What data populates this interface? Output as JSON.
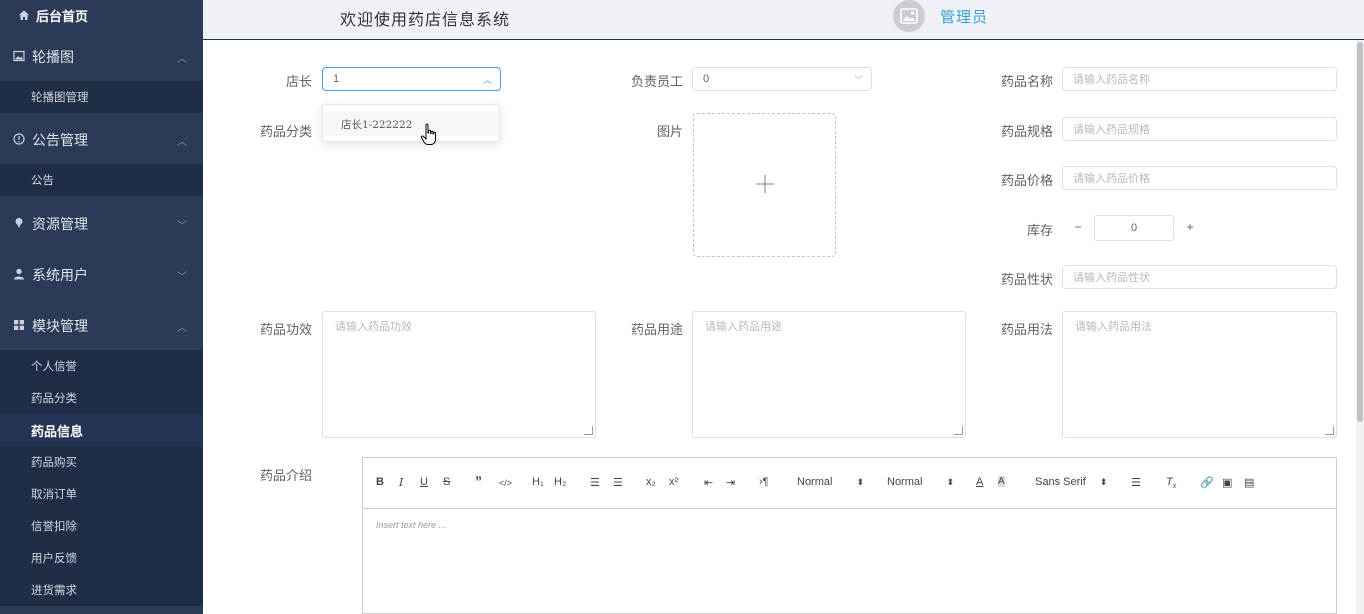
{
  "header": {
    "welcome": "欢迎使用药店信息系统",
    "user": "管理员"
  },
  "sidebar": {
    "home": "后台首页",
    "menus": [
      {
        "label": "轮播图",
        "icon": "image-icon",
        "expanded": true,
        "subs": [
          "轮播图管理"
        ]
      },
      {
        "label": "公告管理",
        "icon": "info-icon",
        "expanded": true,
        "subs": [
          "公告"
        ]
      },
      {
        "label": "资源管理",
        "icon": "pin-icon",
        "expanded": false,
        "subs": []
      },
      {
        "label": "系统用户",
        "icon": "user-icon",
        "expanded": false,
        "subs": []
      },
      {
        "label": "模块管理",
        "icon": "grid-icon",
        "expanded": true,
        "subs": [
          "个人信誉",
          "药品分类",
          "药品信息",
          "药品购买",
          "取消订单",
          "信誉扣除",
          "用户反馈",
          "进货需求"
        ],
        "active": "药品信息"
      }
    ]
  },
  "form": {
    "manager_label": "店长",
    "manager_value": "1",
    "staff_label": "负责员工",
    "staff_value": "0",
    "drug_name_label": "药品名称",
    "drug_name_placeholder": "请输入药品名称",
    "category_label": "药品分类",
    "image_label": "图片",
    "spec_label": "药品规格",
    "spec_placeholder": "请输入药品规格",
    "price_label": "药品价格",
    "price_placeholder": "请输入药品价格",
    "stock_label": "库存",
    "stock_value": "0",
    "property_label": "药品性状",
    "property_placeholder": "请输入药品性状",
    "effect_label": "药品功效",
    "effect_placeholder": "请输入药品功效",
    "usage_label": "药品用途",
    "usage_placeholder": "请输入药品用途",
    "method_label": "药品用法",
    "method_placeholder": "请输入药品用法",
    "intro_label": "药品介绍",
    "dropdown_option": "店长1-222222"
  },
  "editor": {
    "header_select": "Normal",
    "size_select": "Normal",
    "font_select": "Sans Serif",
    "placeholder": "Insert text here ..."
  }
}
